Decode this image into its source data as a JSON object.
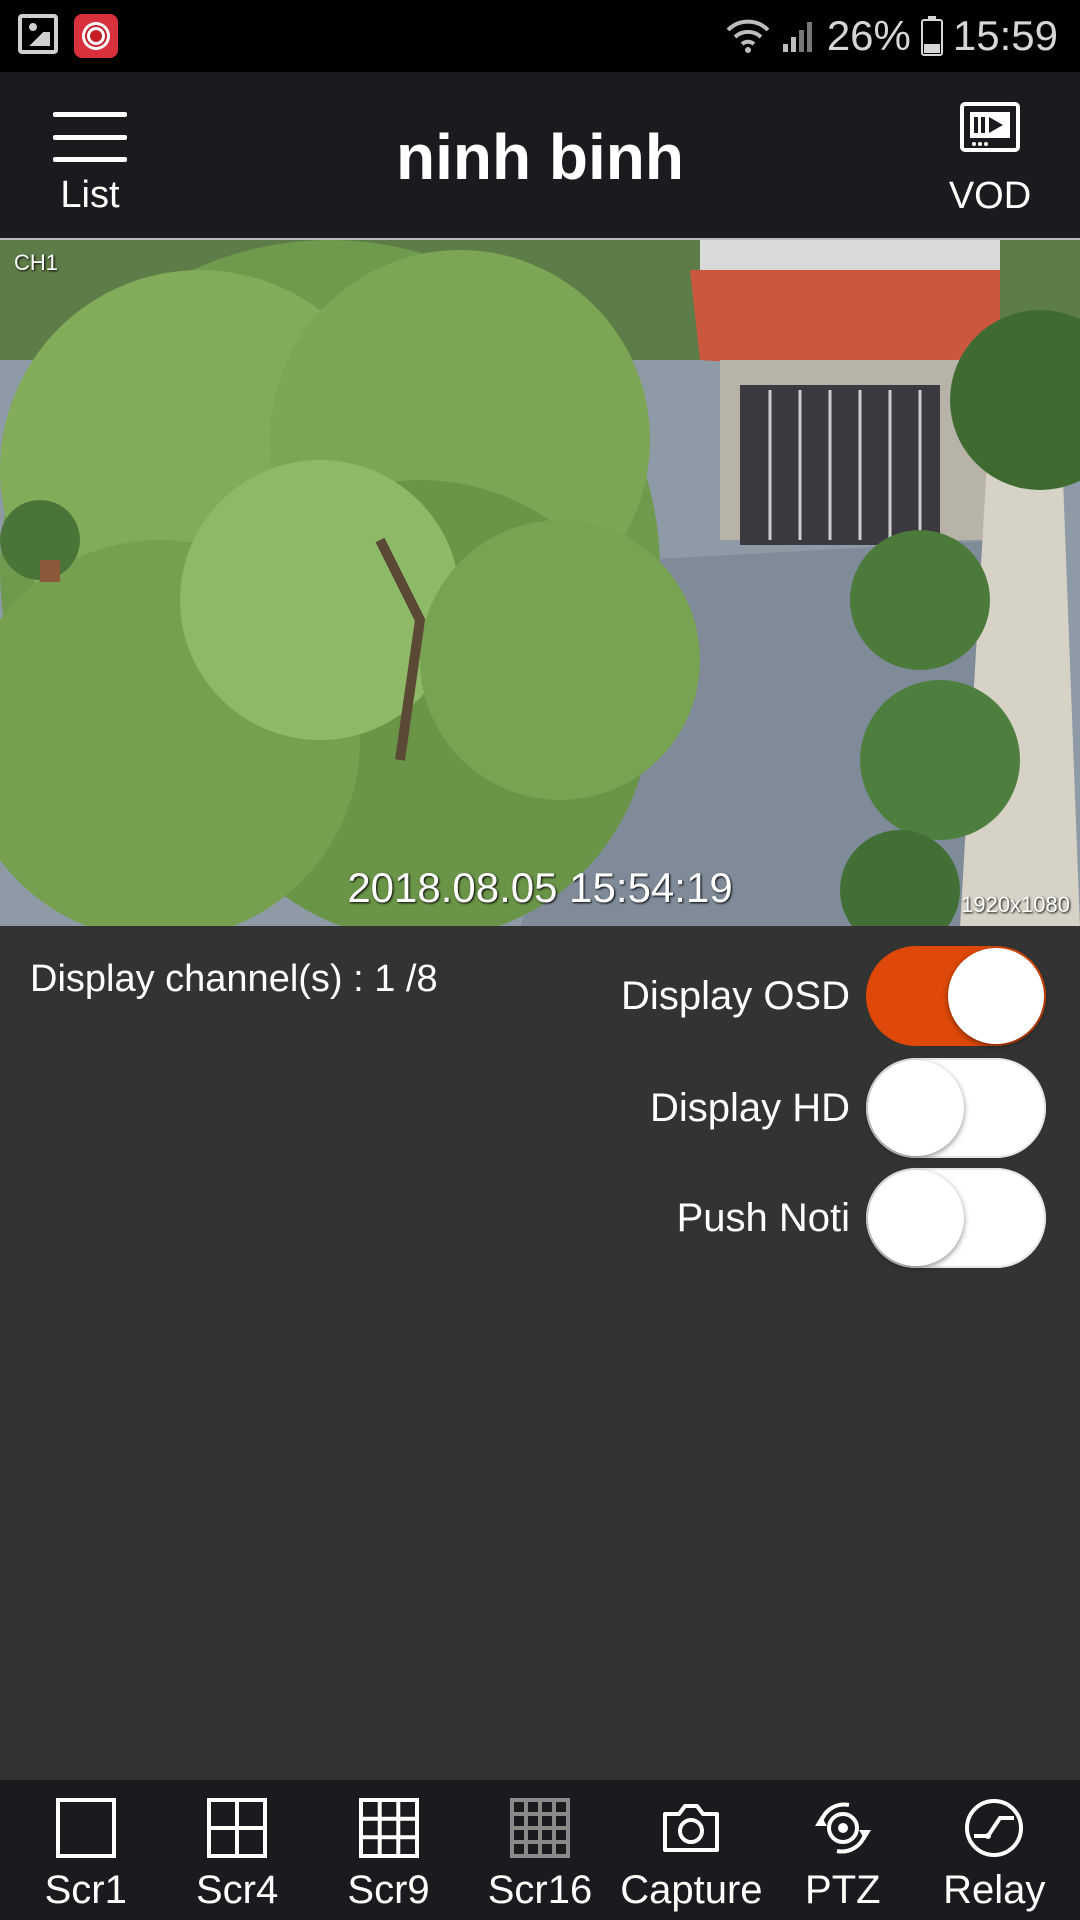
{
  "status_bar": {
    "battery": "26%",
    "time": "15:59",
    "icons": [
      "gallery-icon",
      "camera-app-icon",
      "wifi-icon",
      "signal-icon",
      "battery-icon"
    ]
  },
  "header": {
    "title": "ninh binh",
    "list_label": "List",
    "vod_label": "VOD"
  },
  "video": {
    "channel": "CH1",
    "timestamp": "2018.08.05  15:54:19",
    "resolution": "1920x1080"
  },
  "controls": {
    "channels_text": "Display channel(s) : 1 /8",
    "toggles": [
      {
        "label": "Display OSD",
        "on": true
      },
      {
        "label": "Display HD",
        "on": false
      },
      {
        "label": "Push Noti",
        "on": false
      }
    ],
    "accent_color": "#de4808"
  },
  "bottom_nav": [
    {
      "label": "Scr1",
      "icon": "single-screen-icon"
    },
    {
      "label": "Scr4",
      "icon": "grid-4-icon"
    },
    {
      "label": "Scr9",
      "icon": "grid-9-icon"
    },
    {
      "label": "Scr16",
      "icon": "grid-16-icon"
    },
    {
      "label": "Capture",
      "icon": "camera-icon"
    },
    {
      "label": "PTZ",
      "icon": "ptz-icon"
    },
    {
      "label": "Relay",
      "icon": "relay-icon"
    }
  ]
}
